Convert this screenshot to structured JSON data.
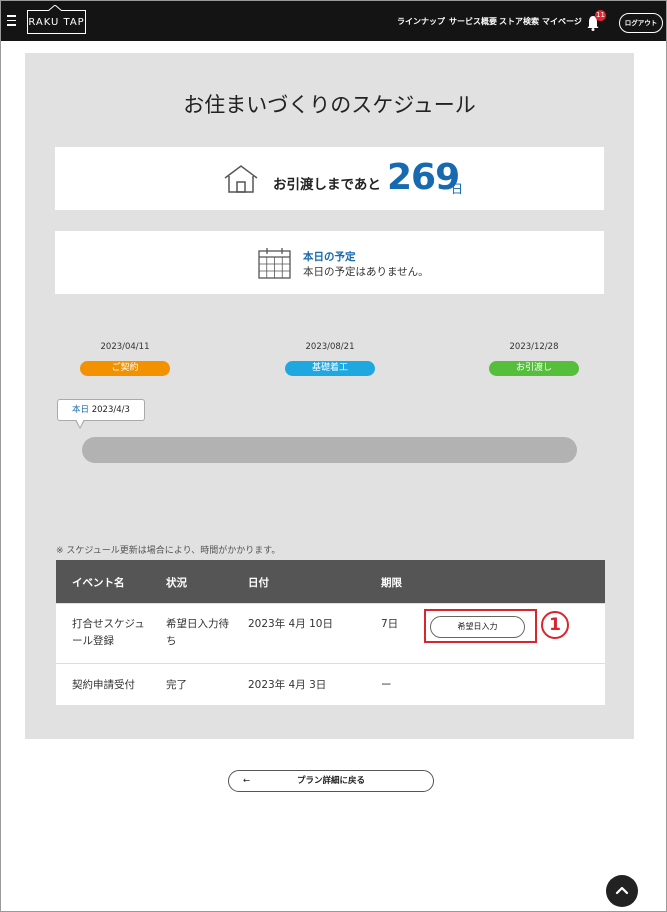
{
  "header": {
    "logo": "RAKU TAP",
    "nav": [
      "ラインナップ",
      "サービス概要",
      "ストア検索",
      "マイページ"
    ],
    "notification_count": "11",
    "logout_label": "ログアウト"
  },
  "page": {
    "title": "お住まいづくりのスケジュール",
    "countdown": {
      "label": "お引渡しまであと",
      "value": "269",
      "unit": "日"
    },
    "today": {
      "title": "本日の予定",
      "text": "本日の予定はありません。"
    }
  },
  "timeline": {
    "milestones": [
      {
        "date": "2023/04/11",
        "label": "ご契約",
        "color": "#f39200"
      },
      {
        "date": "2023/08/21",
        "label": "基礎着工",
        "color": "#1fa8e0"
      },
      {
        "date": "2023/12/28",
        "label": "お引渡し",
        "color": "#55bf3b"
      }
    ],
    "today_marker": {
      "label": "本日",
      "date": "2023/4/3"
    },
    "progress": 0
  },
  "note": "※ スケジュール更新は場合により、時間がかかります。",
  "table": {
    "headers": [
      "イベント名",
      "状況",
      "日付",
      "期限"
    ],
    "rows": [
      {
        "event": [
          "打合せスケジュ",
          "ール登録"
        ],
        "status": [
          "希望日入力待",
          "ち"
        ],
        "date": "2023年 4月 10日",
        "deadline": "7日",
        "action": "希望日入力"
      },
      {
        "event": [
          "契約申請受付"
        ],
        "status": [
          "完了"
        ],
        "date": "2023年 4月 3日",
        "deadline": "ー",
        "action": ""
      }
    ]
  },
  "annotation": {
    "number": "1",
    "color": "#d9262e"
  },
  "back_button": {
    "arrow": "←",
    "label": "プラン詳細に戻る"
  }
}
